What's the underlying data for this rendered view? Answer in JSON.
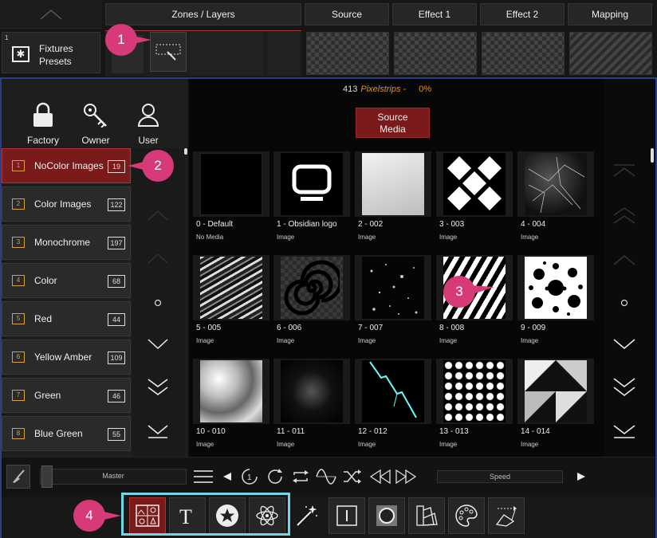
{
  "top": {
    "fixtures": {
      "index": "1",
      "line1": "Fixtures",
      "line2": "Presets"
    },
    "columns": [
      "Zones / Layers",
      "Source",
      "Effect 1",
      "Effect 2",
      "Mapping"
    ]
  },
  "header": {
    "count": "413",
    "name": "Pixelstrips -",
    "percent": "0%",
    "source_media_line1": "Source",
    "source_media_line2": "Media"
  },
  "permissions": [
    {
      "label": "Factory",
      "icon": "lock-icon"
    },
    {
      "label": "Owner",
      "icon": "key-icon"
    },
    {
      "label": "User",
      "icon": "user-icon"
    }
  ],
  "categories": [
    {
      "index": "1",
      "name": "NoColor Images",
      "count": "19",
      "selected": true
    },
    {
      "index": "2",
      "name": "Color Images",
      "count": "122"
    },
    {
      "index": "3",
      "name": "Monochrome",
      "count": "197"
    },
    {
      "index": "4",
      "name": "Color",
      "count": "68"
    },
    {
      "index": "5",
      "name": "Red",
      "count": "44"
    },
    {
      "index": "6",
      "name": "Yellow Amber",
      "count": "109"
    },
    {
      "index": "7",
      "name": "Green",
      "count": "46"
    },
    {
      "index": "8",
      "name": "Blue Green",
      "count": "55"
    }
  ],
  "media": [
    {
      "name": "0 - Default",
      "type": "No Media"
    },
    {
      "name": "1 - Obsidian logo",
      "type": "Image"
    },
    {
      "name": "2 - 002",
      "type": "Image"
    },
    {
      "name": "3 - 003",
      "type": "Image"
    },
    {
      "name": "4 - 004",
      "type": "Image"
    },
    {
      "name": "5 - 005",
      "type": "Image"
    },
    {
      "name": "6 - 006",
      "type": "Image"
    },
    {
      "name": "7 - 007",
      "type": "Image"
    },
    {
      "name": "8 - 008",
      "type": "Image"
    },
    {
      "name": "9 - 009",
      "type": "Image"
    },
    {
      "name": "10 - 010",
      "type": "Image"
    },
    {
      "name": "11 - 011",
      "type": "Image"
    },
    {
      "name": "12 - 012",
      "type": "Image"
    },
    {
      "name": "13 - 013",
      "type": "Image"
    },
    {
      "name": "14 - 014",
      "type": "Image"
    }
  ],
  "transport": {
    "master_label": "Master",
    "speed_label": "Speed"
  },
  "callouts": [
    "1",
    "2",
    "3",
    "4"
  ],
  "colors": {
    "accent_red": "#7a1a1a",
    "highlight_cyan": "#6fd8e8",
    "callout_pink": "#d63a78",
    "status_orange": "#e0902a"
  }
}
